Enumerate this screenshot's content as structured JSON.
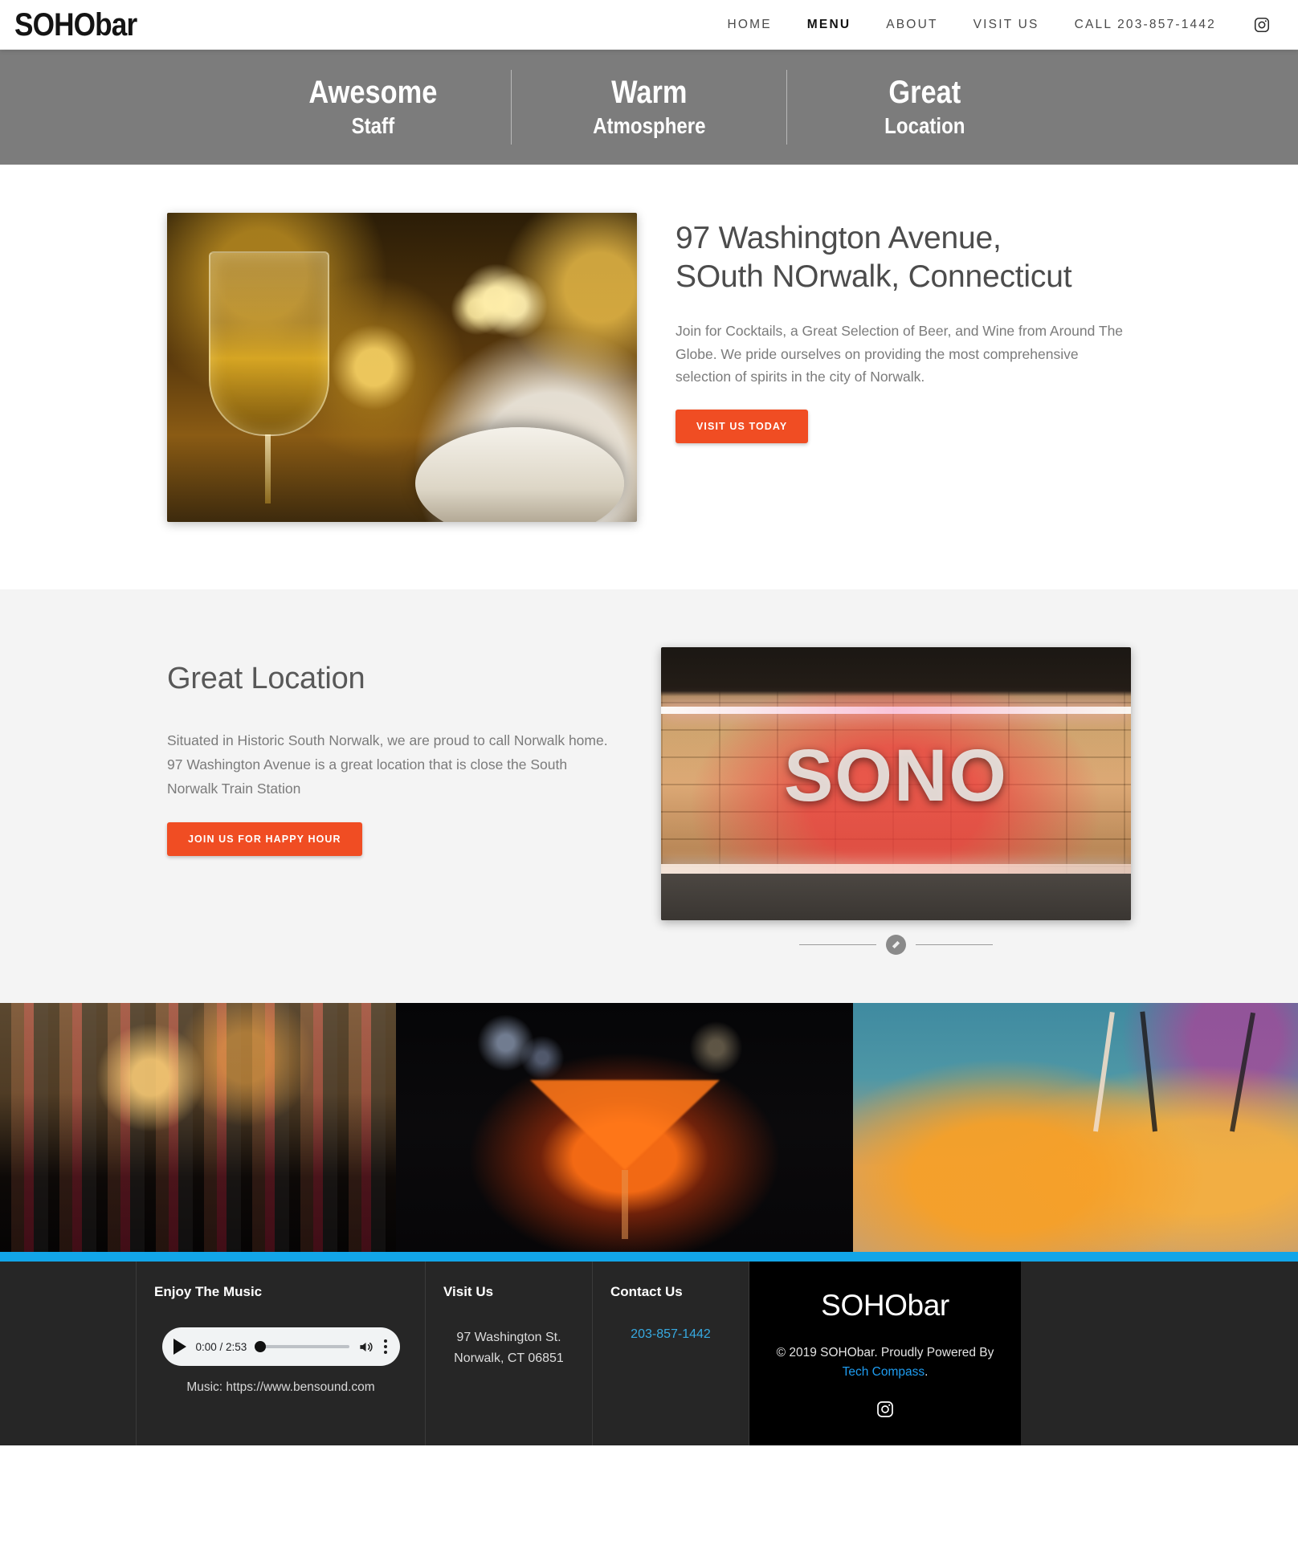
{
  "header": {
    "brand": "SOHObar",
    "nav": [
      {
        "label": "HOME",
        "active": false
      },
      {
        "label": "MENU",
        "active": true
      },
      {
        "label": "ABOUT",
        "active": false
      },
      {
        "label": "VISIT US",
        "active": false
      },
      {
        "label": "CALL 203-857-1442",
        "active": false
      }
    ],
    "instagram_icon": "instagram-icon"
  },
  "feature_band": {
    "background_color": "#7c7c7c",
    "columns": [
      {
        "title": "Awesome",
        "subtitle": "Staff"
      },
      {
        "title": "Warm",
        "subtitle": "Atmosphere"
      },
      {
        "title": "Great",
        "subtitle": "Location"
      }
    ]
  },
  "intro": {
    "heading_line1": "97 Washington Avenue,",
    "heading_line2": "SOuth NOrwalk, Connecticut",
    "paragraph": "Join for Cocktails, a Great Selection of Beer, and Wine from Around The Globe.  We pride ourselves on providing the most comprehensive selection of spirits in the city of Norwalk.",
    "button_label": "VISIT US TODAY",
    "photo_alt": "wine-glass-and-bowl-photo"
  },
  "location": {
    "heading": "Great Location",
    "paragraph": "Situated in Historic South Norwalk, we are proud to call Norwalk home.  97 Washington Avenue is a great location that is close the South Norwalk Train Station",
    "button_label": "JOIN US FOR HAPPY HOUR",
    "slide_text": "SONO",
    "slider_icon": "slider-pause-icon"
  },
  "gallery": {
    "images": [
      {
        "alt": "bar-bottles-photo"
      },
      {
        "alt": "glowing-martini-photo"
      },
      {
        "alt": "aperol-spritz-cocktails-photo"
      }
    ]
  },
  "divider": {
    "color": "#12a5e8"
  },
  "footer": {
    "music": {
      "title": "Enjoy The Music",
      "player": {
        "time": "0:00 / 2:53",
        "play_icon": "play-icon",
        "volume_icon": "volume-icon",
        "menu_icon": "kebab-menu-icon"
      },
      "credit": "Music: https://www.bensound.com"
    },
    "visit": {
      "title": "Visit Us",
      "address_line1": "97 Washington St.",
      "address_line2": "Norwalk, CT 06851"
    },
    "contact": {
      "title": "Contact Us",
      "phone": "203-857-1442",
      "phone_color": "#37a9e0"
    },
    "brand_block": {
      "brand": "SOHObar",
      "copyright_prefix": "©  2019 SOHObar. Proudly Powered By ",
      "credit_link": "Tech Compass",
      "copyright_suffix": ".",
      "instagram_icon": "instagram-icon"
    }
  }
}
